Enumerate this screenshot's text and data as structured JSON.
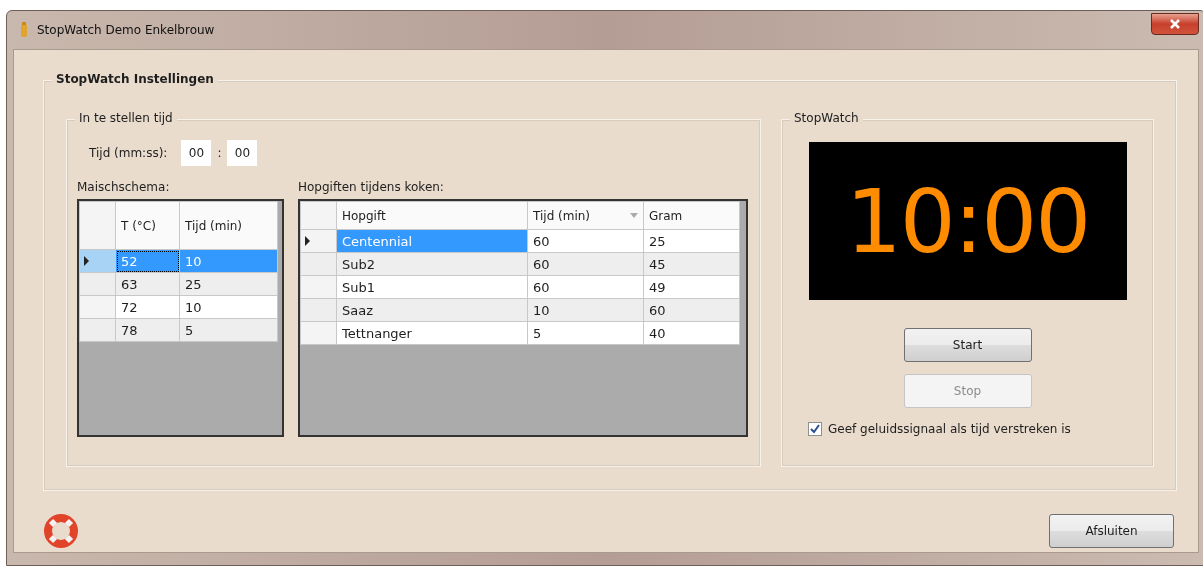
{
  "window": {
    "title": "StopWatch Demo Enkelbrouw"
  },
  "settings_group": {
    "title": "StopWatch Instellingen"
  },
  "time_group": {
    "title": "In te stellen tijd",
    "time_label": "Tijd (mm:ss):",
    "minutes": "00",
    "separator": ":",
    "seconds": "00"
  },
  "mash_table": {
    "label": "Maischschema:",
    "columns": [
      "T (°C)",
      "Tijd (min)"
    ],
    "rows": [
      {
        "cells": [
          "52",
          "10"
        ],
        "selected": true
      },
      {
        "cells": [
          "63",
          "25"
        ],
        "selected": false
      },
      {
        "cells": [
          "72",
          "10"
        ],
        "selected": false
      },
      {
        "cells": [
          "78",
          "5"
        ],
        "selected": false
      }
    ]
  },
  "hop_table": {
    "label": "Hopgiften tijdens koken:",
    "columns": [
      {
        "label": "Hopgift",
        "sorted": false
      },
      {
        "label": "Tijd (min)",
        "sorted": true
      },
      {
        "label": "Gram",
        "sorted": false
      }
    ],
    "rows": [
      {
        "cells": [
          "Centennial",
          "60",
          "25"
        ],
        "selected": true
      },
      {
        "cells": [
          "Sub2",
          "60",
          "45"
        ],
        "selected": false
      },
      {
        "cells": [
          "Sub1",
          "60",
          "49"
        ],
        "selected": false
      },
      {
        "cells": [
          "Saaz",
          "10",
          "60"
        ],
        "selected": false
      },
      {
        "cells": [
          "Tettnanger",
          "5",
          "40"
        ],
        "selected": false
      }
    ]
  },
  "stopwatch_group": {
    "title": "StopWatch",
    "display": "10:00",
    "buttons": [
      {
        "label": "Start",
        "disabled": false
      },
      {
        "label": "Stop",
        "disabled": true
      }
    ],
    "sound_checkbox": {
      "label": "Geef geluidssignaal als tijd verstreken is",
      "checked": true
    }
  },
  "footer": {
    "close_button": "Afsluiten"
  }
}
